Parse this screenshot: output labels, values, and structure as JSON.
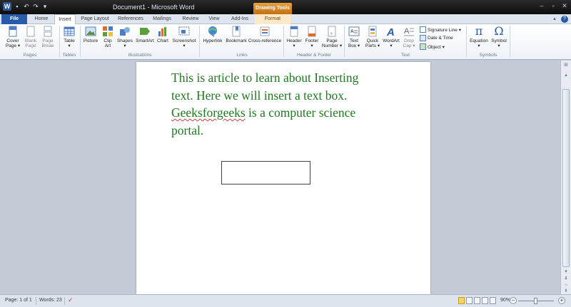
{
  "window": {
    "title": "Document1 - Microsoft Word",
    "context_tab_group": "Drawing Tools"
  },
  "tabs": [
    {
      "label": "File"
    },
    {
      "label": "Home"
    },
    {
      "label": "Insert"
    },
    {
      "label": "Page Layout"
    },
    {
      "label": "References"
    },
    {
      "label": "Mailings"
    },
    {
      "label": "Review"
    },
    {
      "label": "View"
    },
    {
      "label": "Add-Ins"
    },
    {
      "label": "Format"
    }
  ],
  "ribbon": {
    "pages": {
      "group": "Pages",
      "cover": "Cover",
      "cover2": "Page ▾",
      "blank": "Blank",
      "blank2": "Page",
      "break": "Page",
      "break2": "Break"
    },
    "tables": {
      "group": "Tables",
      "table": "Table",
      "table2": "▾"
    },
    "illustrations": {
      "group": "Illustrations",
      "picture": "Picture",
      "clip": "Clip",
      "clip2": "Art",
      "shapes": "Shapes",
      "shapes2": "▾",
      "smartart": "SmartArt",
      "chart": "Chart",
      "screenshot": "Screenshot",
      "screenshot2": "▾"
    },
    "links": {
      "group": "Links",
      "hyperlink": "Hyperlink",
      "bookmark": "Bookmark",
      "crossref": "Cross-reference"
    },
    "header_footer": {
      "group": "Header & Footer",
      "header": "Header",
      "header2": "▾",
      "footer": "Footer",
      "footer2": "▾",
      "pagenum": "Page",
      "pagenum2": "Number ▾"
    },
    "text": {
      "group": "Text",
      "textbox": "Text",
      "textbox2": "Box ▾",
      "quickparts": "Quick",
      "quickparts2": "Parts ▾",
      "wordart": "WordArt",
      "wordart2": "▾",
      "dropcap": "Drop",
      "dropcap2": "Cap ▾",
      "signature": "Signature Line ▾",
      "datetime": "Date & Time",
      "object": "Object ▾"
    },
    "symbols": {
      "group": "Symbols",
      "equation": "Equation",
      "equation2": "▾",
      "symbol": "Symbol",
      "symbol2": "▾"
    }
  },
  "document": {
    "line1": "This is article to learn about Inserting",
    "line2": "text. Here we will insert a text box.",
    "line3_word": "Geeksforgeeks",
    "line3_rest": " is a computer science",
    "line4": "portal."
  },
  "status": {
    "page": "Page: 1 of 1",
    "words": "Words: 23",
    "zoom": "90%"
  },
  "colors": {
    "text_green": "#1e7a1e",
    "file_tab": "#2a5ba8",
    "context_tab": "#e8a23b"
  }
}
